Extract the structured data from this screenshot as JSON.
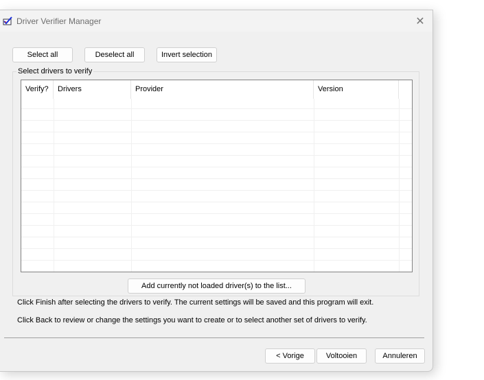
{
  "window": {
    "title": "Driver Verifier Manager",
    "icon": "driver-verifier-checkmark-icon",
    "close_icon": "close-icon"
  },
  "toolbar": {
    "select_all": "Select all",
    "deselect_all": "Deselect all",
    "invert_selection": "Invert selection"
  },
  "group": {
    "label": "Select drivers to verify"
  },
  "table": {
    "columns": [
      "Verify?",
      "Drivers",
      "Provider",
      "Version"
    ],
    "rows": []
  },
  "add_button": "Add currently not loaded driver(s) to the list...",
  "messages": {
    "finish": "Click Finish after selecting the drivers to verify. The current settings will be saved and this program will exit.",
    "back": "Click Back to review or change the settings you want to create or to select another set of drivers to verify."
  },
  "footer": {
    "back": "< Vorige",
    "finish": "Voltooien",
    "cancel": "Annuleren"
  }
}
